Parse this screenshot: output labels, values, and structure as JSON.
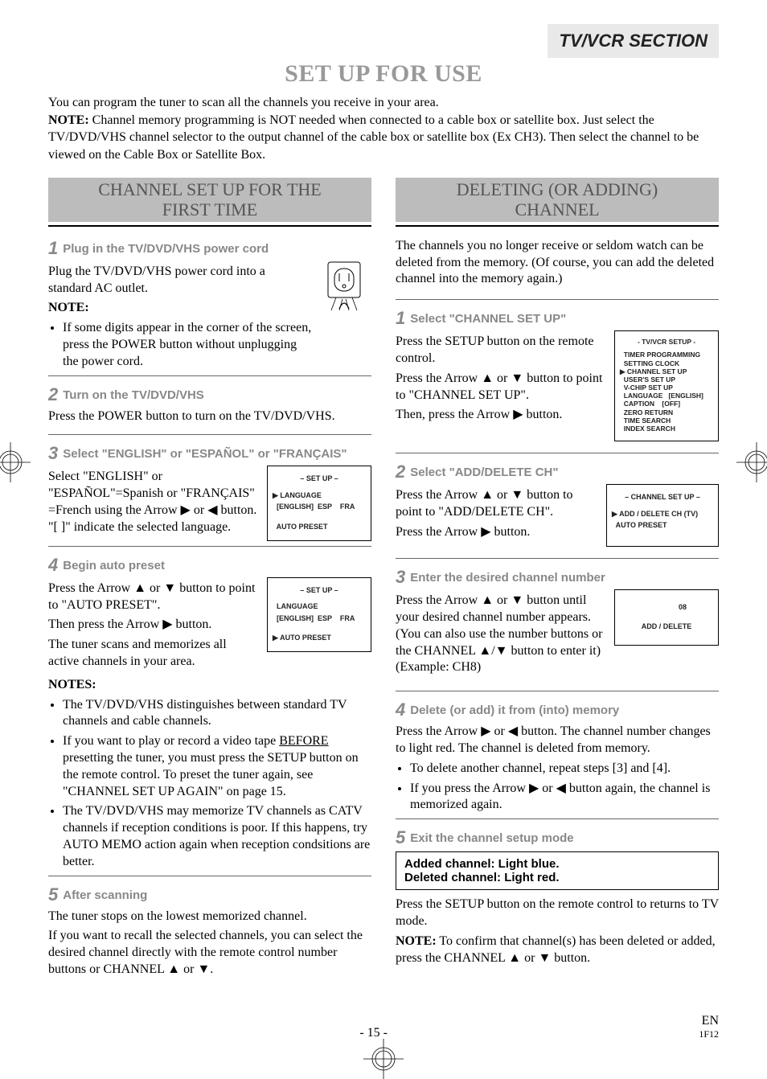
{
  "section_tag": "TV/VCR SECTION",
  "main_title": "SET UP FOR USE",
  "intro_line1": "You can program the tuner to scan all the channels you receive in your area.",
  "intro_note_label": "NOTE:",
  "intro_note_text": " Channel memory programming is NOT needed when connected to a cable box or satellite box. Just select the TV/DVD/VHS channel selector to the output channel of the cable box or satellite box (Ex CH3). Then select the channel to be viewed on the Cable Box or Satellite Box.",
  "left": {
    "title_l1": "CHANNEL SET UP FOR THE",
    "title_l2": "FIRST TIME",
    "step1": {
      "num": "1",
      "head": "Plug in the TV/DVD/VHS power cord",
      "body": "Plug the TV/DVD/VHS power cord into a standard AC outlet.",
      "note_label": "NOTE:",
      "bullet": "If some digits appear in the corner of the screen, press the POWER button without unplugging the power cord."
    },
    "step2": {
      "num": "2",
      "head": "Turn on the TV/DVD/VHS",
      "body": "Press the POWER button to turn on the TV/DVD/VHS."
    },
    "step3": {
      "num": "3",
      "head": "Select \"ENGLISH\" or \"ESPAÑOL\" or \"FRANÇAIS\"",
      "body": "Select \"ENGLISH\" or \"ESPAÑOL\"=Spanish or \"FRANÇAIS\" =French using the Arrow ▶ or ◀ button. \"[ ]\" indicate the selected language.",
      "osd": {
        "title": "– SET UP –",
        "row1": "▶ LANGUAGE",
        "row2": "  [ENGLISH]  ESP    FRA",
        "row3": "  AUTO PRESET"
      }
    },
    "step4": {
      "num": "4",
      "head": "Begin auto preset",
      "body_l1": "Press the Arrow ▲ or ▼ button to point to \"AUTO PRESET\".",
      "body_l2": "Then press the Arrow ▶ button.",
      "body_l3": "The tuner scans and memorizes all active channels in your area.",
      "notes_label": "NOTES:",
      "notes": [
        "The TV/DVD/VHS distinguishes between standard TV channels and cable channels.",
        "If you want to play or record a video tape BEFORE presetting the tuner, you must press the SETUP button on the remote control. To preset the tuner again, see \"CHANNEL SET UP AGAIN\" on page 15.",
        "The TV/DVD/VHS may memorize TV channels as CATV channels if reception conditions is poor. If this happens, try AUTO MEMO action again when reception condsitions are better."
      ],
      "osd": {
        "title": "– SET UP –",
        "row1": "  LANGUAGE",
        "row2": "  [ENGLISH]  ESP    FRA",
        "row3": "▶ AUTO PRESET"
      }
    },
    "step5": {
      "num": "5",
      "head": "After scanning",
      "body_l1": "The tuner stops on the lowest memorized channel.",
      "body_l2": "If you want to recall the selected channels, you can select the desired channel directly with the remote control number buttons or CHANNEL ▲ or ▼."
    }
  },
  "right": {
    "title_l1": "DELETING (OR ADDING)",
    "title_l2": "CHANNEL",
    "intro": "The channels you no longer receive or seldom watch can be deleted from the memory. (Of course, you can add the deleted channel into the memory again.)",
    "step1": {
      "num": "1",
      "head": "Select \"CHANNEL SET UP\"",
      "body_l1": "Press the SETUP button on the remote control.",
      "body_l2": "Press the Arrow ▲ or ▼ button to point to \"CHANNEL SET UP\".",
      "body_l3": "Then, press the Arrow ▶ button.",
      "osd": {
        "title": "- TV/VCR SETUP -",
        "rows": [
          "  TIMER PROGRAMMING",
          "  SETTING CLOCK",
          "▶ CHANNEL SET UP",
          "  USER'S SET UP",
          "  V-CHIP SET UP",
          "  LANGUAGE   [ENGLISH]",
          "  CAPTION    [OFF]",
          "  ZERO RETURN",
          "  TIME SEARCH",
          "  INDEX SEARCH"
        ]
      }
    },
    "step2": {
      "num": "2",
      "head": "Select \"ADD/DELETE CH\"",
      "body_l1": "Press the Arrow ▲ or ▼ button to point to \"ADD/DELETE CH\".",
      "body_l2": "Press the Arrow ▶ button.",
      "osd": {
        "title": "– CHANNEL SET UP –",
        "row1": "▶ ADD / DELETE CH (TV)",
        "row2": "  AUTO PRESET"
      }
    },
    "step3": {
      "num": "3",
      "head": "Enter the desired channel number",
      "body": "Press the Arrow ▲ or ▼ button until your desired channel number appears. (You can also use the number buttons  or the CHANNEL ▲/▼ button to enter it) (Example: CH8)",
      "osd": {
        "ch": "08",
        "ad": "ADD / DELETE"
      }
    },
    "step4": {
      "num": "4",
      "head": "Delete (or add) it from (into) memory",
      "body": "Press the Arrow ▶ or ◀ button. The channel number changes to light red. The channel is deleted from memory.",
      "bullets": [
        "To delete another channel, repeat steps [3] and [4].",
        "If you press the Arrow ▶ or ◀ button again, the channel is memorized again."
      ]
    },
    "step5": {
      "num": "5",
      "head": "Exit the channel setup mode",
      "status_l1": "Added channel: Light blue.",
      "status_l2": "Deleted channel: Light red.",
      "body_l1": "Press the SETUP button on the remote control to returns to TV mode.",
      "note_label": "NOTE:",
      "note_text": " To confirm that channel(s) has been deleted or added, press the CHANNEL ▲ or ▼ button."
    }
  },
  "footer": {
    "page": "- 15 -",
    "lang": "EN",
    "code": "1F12"
  }
}
